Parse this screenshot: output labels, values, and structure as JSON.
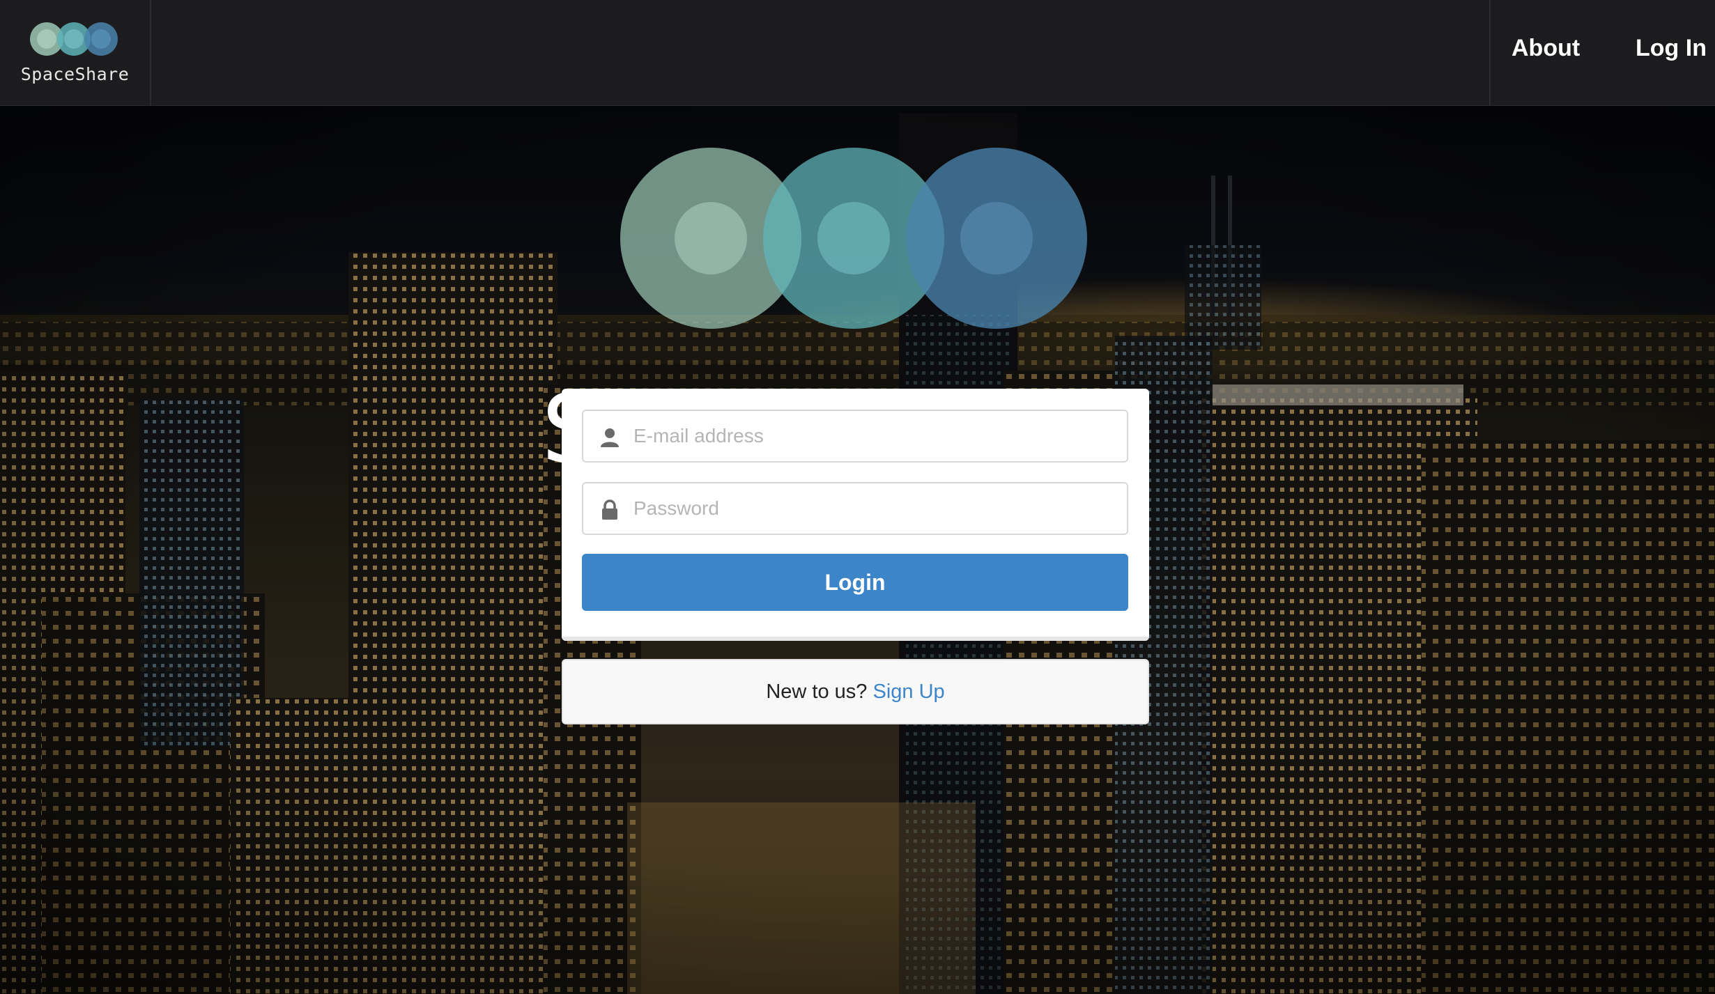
{
  "navbar": {
    "brand_name": "SpaceShare",
    "links": {
      "about": "About",
      "login": "Log In"
    }
  },
  "hero": {
    "title": "SpaceShare",
    "background": "night city skyline"
  },
  "login_form": {
    "email_placeholder": "E-mail address",
    "password_placeholder": "Password",
    "submit_label": "Login",
    "email_icon": "user-icon",
    "password_icon": "lock-icon"
  },
  "signup": {
    "prompt": "New to us?",
    "link": "Sign Up"
  },
  "colors": {
    "navbar_bg": "#1c1c1e",
    "primary": "#3d85c9",
    "logo_circle_1": "#9cc7b5",
    "logo_circle_2": "#5fb3b8",
    "logo_circle_3": "#4a84ad"
  }
}
